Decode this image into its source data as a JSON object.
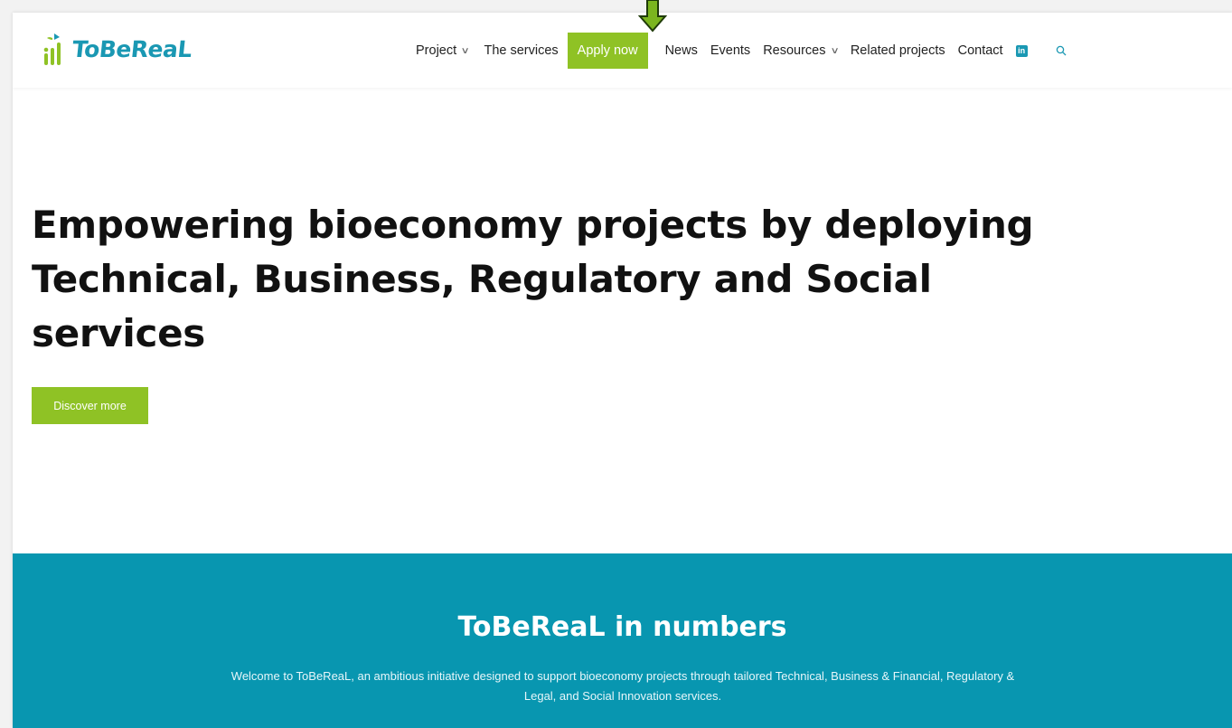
{
  "brand": {
    "name": "ToBeReaL"
  },
  "nav": {
    "project": "Project",
    "services": "The services",
    "apply": "Apply now",
    "news": "News",
    "events": "Events",
    "resources": "Resources",
    "related": "Related projects",
    "contact": "Contact",
    "linkedin_icon": "in",
    "chevron": "∨"
  },
  "hero": {
    "title": "Empowering bioeconomy projects by deploying Technical, Business, Regulatory and Social services",
    "cta": "Discover more"
  },
  "numbers": {
    "title": "ToBeReaL in numbers",
    "text": "Welcome to ToBeReaL, an ambitious initiative designed to support bioeconomy projects through tailored Technical, Business & Financial, Regulatory & Legal, and Social Innovation services."
  },
  "colors": {
    "accent_green": "#8fc225",
    "brand_teal": "#0896b0",
    "arrow_green": "#7bb51f"
  },
  "icons": [
    "linkedin-icon",
    "search-icon",
    "chevron-down-icon",
    "arrow-down-icon",
    "logo-icon"
  ]
}
